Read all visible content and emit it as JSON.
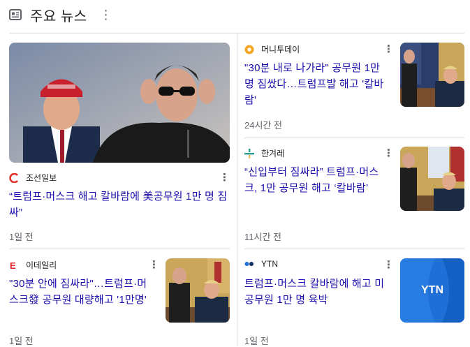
{
  "header": {
    "title": "주요 뉴스",
    "news_icon": "newspaper-icon",
    "more_icon": "more-vert-icon"
  },
  "left": {
    "featured": {
      "source": "조선일보",
      "source_logo": "chosun-logo",
      "headline": "“트럼프·머스크 해고 칼바람에 美공무원 1만 명 짐 싸”",
      "time": "1일 전",
      "image_alt": "photo-trump-musk"
    },
    "second": {
      "source": "이데일리",
      "source_logo": "edaily-logo",
      "headline": "\"30분 안에 짐싸라\"…트럼프·머스크發 공무원 대량해고 '1만명'",
      "time": "1일 전",
      "image_alt": "photo-oval-office"
    }
  },
  "right": {
    "items": [
      {
        "source": "머니투데이",
        "source_logo": "mt-logo",
        "headline": "\"30분 내로 나가라\" 공무원 1만명 짐쌌다…트럼프발 해고 '칼바람'",
        "time": "24시간 전"
      },
      {
        "source": "한겨레",
        "source_logo": "hani-logo",
        "headline": "“신입부터 짐싸라” 트럼프·머스크, 1만 공무원 해고 ‘칼바람’",
        "time": "11시간 전"
      },
      {
        "source": "YTN",
        "source_logo": "ytn-logo",
        "headline": "트럼프·머스크 칼바람에 해고 미 공무원 1만 명 육박",
        "time": "1일 전",
        "thumb_text": "YTN"
      }
    ]
  },
  "colors": {
    "link": "#1a0dab",
    "meta": "#5f6368",
    "divider": "#dadce0",
    "chosun": "#e4302b",
    "edaily": "#e0242b",
    "mt": "#f5a623",
    "ytn": "#1f6fd6"
  }
}
